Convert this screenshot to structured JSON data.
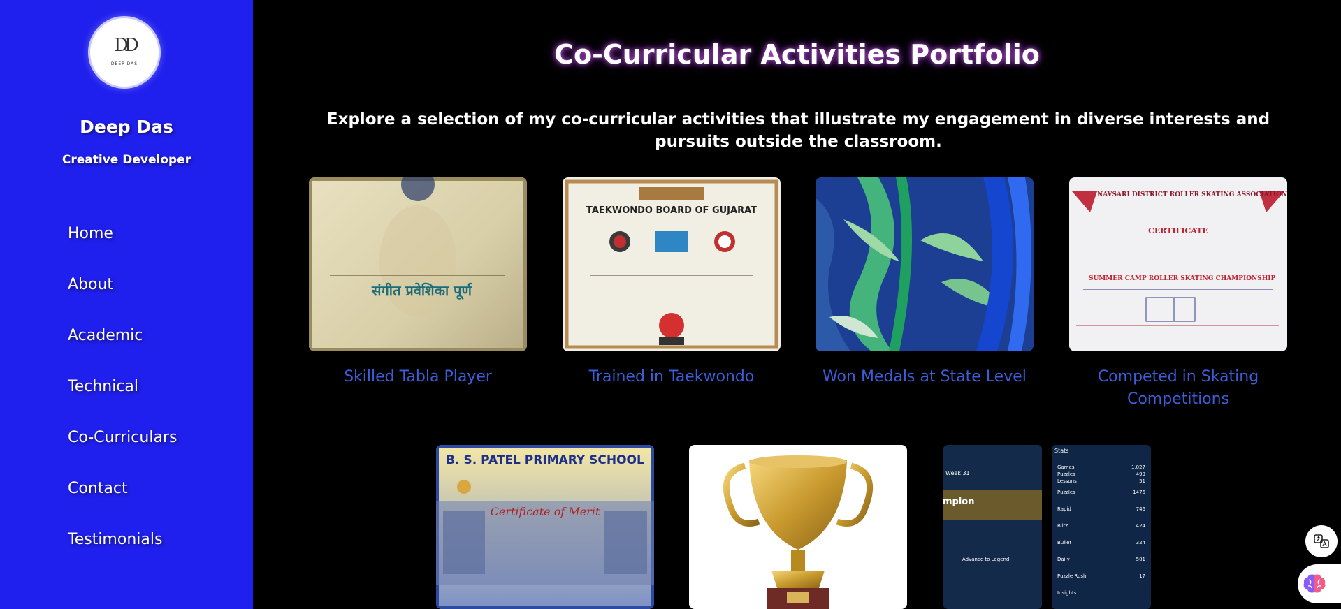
{
  "profile": {
    "logo_monogram": "DD",
    "logo_name": "DEEP DAS",
    "name": "Deep Das",
    "role": "Creative Developer"
  },
  "nav": [
    "Home",
    "About",
    "Academic",
    "Technical",
    "Co-Curriculars",
    "Contact",
    "Testimonials"
  ],
  "page": {
    "title": "Co-Curricular Activities Portfolio",
    "intro": "Explore a selection of my co-curricular activities that illustrate my engagement in diverse interests and pursuits outside the classroom."
  },
  "cards": [
    {
      "caption": "Skilled Tabla Player",
      "image_text": "संगीत प्रवेशिका पूर्ण"
    },
    {
      "caption": "Trained in Taekwondo",
      "image_text": "TAEKWONDO BOARD OF GUJARAT"
    },
    {
      "caption": "Won Medals at State Level"
    },
    {
      "caption": "Competed in Skating Competitions",
      "image_text": "NAVSARI DISTRICT ROLLER SKATING ASSOCIATION",
      "image_subtext": "CERTIFICATE",
      "image_event": "SUMMER CAMP ROLLER SKATING CHAMPIONSHIP"
    },
    {
      "image_text": "B. S. PATEL PRIMARY SCHOOL",
      "image_subtext": "Certificate of Merit"
    },
    {},
    {
      "stats_title": "Stats",
      "week_label": "Week 31",
      "banner": "mpion",
      "banner_sub": "Advance to Legend",
      "stats": [
        {
          "label": "Games",
          "value": "1,027"
        },
        {
          "label": "Puzzles",
          "value": "499"
        },
        {
          "label": "Lessons",
          "value": "51"
        },
        {
          "label": "Puzzles",
          "value": "1476"
        },
        {
          "label": "Rapid",
          "value": "746"
        },
        {
          "label": "Blitz",
          "value": "424"
        },
        {
          "label": "Bullet",
          "value": "324"
        },
        {
          "label": "Daily",
          "value": "501"
        },
        {
          "label": "Puzzle Rush",
          "value": "17"
        },
        {
          "label": "Insights",
          "value": ""
        }
      ]
    }
  ],
  "colors": {
    "sidebar": "#2020ee",
    "background": "#000000",
    "caption": "#3b5dd8",
    "title_glow": "#c040ff"
  }
}
